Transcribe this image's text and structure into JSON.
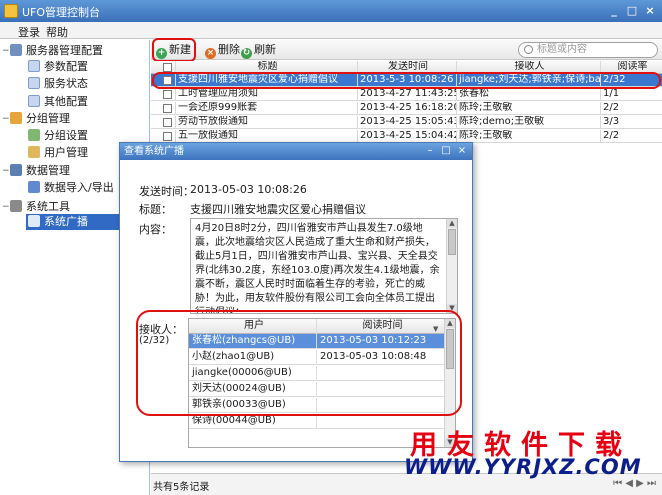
{
  "window": {
    "title": "UFO管理控制台",
    "minimize": "_",
    "maximize": "□",
    "close": "×"
  },
  "menu": [
    "登录",
    "帮助"
  ],
  "sidebar": {
    "groups": [
      {
        "label": "服务器管理配置",
        "items": [
          "参数配置",
          "服务状态",
          "其他配置"
        ]
      },
      {
        "label": "分组管理",
        "items": [
          "分组设置",
          "用户管理"
        ]
      },
      {
        "label": "数据管理",
        "items": [
          "数据导入/导出"
        ]
      },
      {
        "label": "系统工具",
        "items": [
          "系统广播"
        ]
      }
    ],
    "selected": "系统广播"
  },
  "toolbar": {
    "new": "新建",
    "delete": "删除",
    "refresh": "刷新",
    "search_placeholder": "标题或内容"
  },
  "grid": {
    "columns": [
      "标题",
      "发送时间",
      "接收人",
      "阅读率"
    ],
    "rows": [
      {
        "title": "支援四川雅安地震灾区爱心捐赠倡议",
        "time": "2013-5-3 10:08:26",
        "receivers": "jiangke;刘天达;郭铁亲;保诗;bai",
        "rate": "2/32",
        "selected": true
      },
      {
        "title": "工时管理应用须知",
        "time": "2013-4-27 11:43:25",
        "receivers": "张春松",
        "rate": "1/1",
        "selected": false
      },
      {
        "title": "一会还原999账套",
        "time": "2013-4-25 16:18:20",
        "receivers": "陈玲;王敬敏",
        "rate": "2/2",
        "selected": false
      },
      {
        "title": "劳动节放假通知",
        "time": "2013-4-25 15:05:43",
        "receivers": "陈玲;demo;王敬敏",
        "rate": "3/3",
        "selected": false
      },
      {
        "title": "五一放假通知",
        "time": "2013-4-25 15:04:42",
        "receivers": "陈玲;王敬敏",
        "rate": "2/2",
        "selected": false
      }
    ]
  },
  "statusbar": {
    "text": "共有5条记录",
    "pager": "⏮ ◀ ▶ ⏭"
  },
  "dialog": {
    "title": "查看系统广播",
    "send_time_label": "发送时间：",
    "send_time": "2013-05-03 10:08:26",
    "title_label": "标题：",
    "title_value": "支援四川雅安地震灾区爱心捐赠倡议",
    "content_label": "内容：",
    "content": "4月20日8时2分，四川省雅安市芦山县发生7.0级地震，此次地震给灾区人民造成了重大生命和财产损失，截止5月1日，四川省雅安市芦山县、宝兴县、天全县交界(北纬30.2度，东经103.0度)再次发生4.1级地震，余震不断，震区人民时时面临着生存的考验，死亡的威胁！为此，用友软件股份有限公司工会向全体员工提出行动倡议：",
    "recv_label": "接收人：",
    "recv_count": "(2/32)",
    "recv_columns": [
      "用户",
      "阅读时间"
    ],
    "recv_rows": [
      {
        "user": "张春松(zhangcs@UB)",
        "time": "2013-05-03 10:12:23",
        "selected": true
      },
      {
        "user": "小赵(zhao1@UB)",
        "time": "2013-05-03 10:08:48",
        "selected": false
      },
      {
        "user": "jiangke(00006@UB)",
        "time": "",
        "selected": false
      },
      {
        "user": "刘天达(00024@UB)",
        "time": "",
        "selected": false
      },
      {
        "user": "郭铁亲(00033@UB)",
        "time": "",
        "selected": false
      },
      {
        "user": "保诗(00044@UB)",
        "time": "",
        "selected": false
      }
    ],
    "minimize": "–",
    "restore": "□",
    "close": "×"
  },
  "watermark": {
    "cn": "用友软件下载",
    "url": "WWW.YYRJXZ.COM"
  },
  "colors": {
    "titlebar": "#3a70b8",
    "selection": "#316ac5",
    "highlight_red": "#e01010",
    "watermark_red": "#e60012",
    "watermark_blue": "#0b1e8a"
  }
}
